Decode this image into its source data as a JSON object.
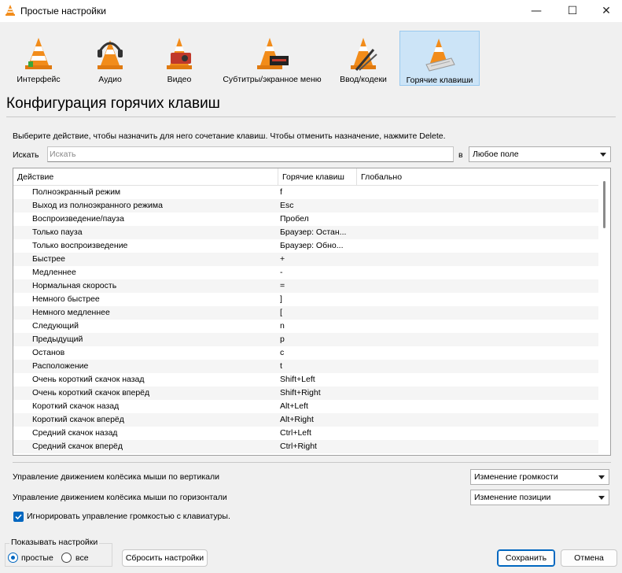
{
  "window": {
    "title": "Простые настройки",
    "minimize": "—",
    "maximize": "☐",
    "close": "✕"
  },
  "categories": [
    {
      "label": "Интерфейс",
      "icon": "cone-interface-icon",
      "selected": false
    },
    {
      "label": "Аудио",
      "icon": "cone-audio-icon",
      "selected": false
    },
    {
      "label": "Видео",
      "icon": "cone-video-icon",
      "selected": false
    },
    {
      "label": "Субтитры/экранное меню",
      "icon": "cone-subtitles-icon",
      "selected": false
    },
    {
      "label": "Ввод/кодеки",
      "icon": "cone-codecs-icon",
      "selected": false
    },
    {
      "label": "Горячие клавиши",
      "icon": "cone-hotkeys-icon",
      "selected": true
    }
  ],
  "page_title": "Конфигурация горячих клавиш",
  "hint": "Выберите действие, чтобы назначить для него сочетание клавиш. Чтобы отменить назначение, нажмите Delete.",
  "search": {
    "label": "Искать",
    "value": "",
    "placeholder": "Искать",
    "in_label": "в",
    "field_value": "Любое поле"
  },
  "table": {
    "headers": {
      "action": "Действие",
      "hotkey": "Горячие клавиш",
      "global": "Глобально"
    },
    "rows": [
      {
        "action": "Полноэкранный режим",
        "hotkey": "f"
      },
      {
        "action": "Выход из полноэкранного режима",
        "hotkey": "Esc"
      },
      {
        "action": "Воспроизведение/пауза",
        "hotkey": "Пробел"
      },
      {
        "action": "Только пауза",
        "hotkey": "Браузер: Остан..."
      },
      {
        "action": "Только воспроизведение",
        "hotkey": "Браузер: Обно..."
      },
      {
        "action": "Быстрее",
        "hotkey": "+"
      },
      {
        "action": "Медленнее",
        "hotkey": "-"
      },
      {
        "action": "Нормальная скорость",
        "hotkey": "="
      },
      {
        "action": "Немного быстрее",
        "hotkey": "]"
      },
      {
        "action": "Немного медленнее",
        "hotkey": "["
      },
      {
        "action": "Следующий",
        "hotkey": "n"
      },
      {
        "action": "Предыдущий",
        "hotkey": "p"
      },
      {
        "action": "Останов",
        "hotkey": "c"
      },
      {
        "action": "Расположение",
        "hotkey": "t"
      },
      {
        "action": "Очень короткий скачок назад",
        "hotkey": "Shift+Left"
      },
      {
        "action": "Очень короткий скачок вперёд",
        "hotkey": "Shift+Right"
      },
      {
        "action": "Короткий скачок назад",
        "hotkey": "Alt+Left"
      },
      {
        "action": "Короткий скачок вперёд",
        "hotkey": "Alt+Right"
      },
      {
        "action": "Средний скачок назад",
        "hotkey": "Ctrl+Left"
      },
      {
        "action": "Средний скачок вперёд",
        "hotkey": "Ctrl+Right"
      }
    ]
  },
  "options": {
    "wheel_vertical_label": "Управление движением колёсика мыши по вертикали",
    "wheel_vertical_value": "Изменение громкости",
    "wheel_horizontal_label": "Управление движением колёсика мыши по горизонтали",
    "wheel_horizontal_value": "Изменение позиции",
    "ignore_volume_label": "Игнорировать управление громкостью с клавиатуры.",
    "ignore_volume_checked": true
  },
  "show_settings": {
    "title": "Показывать настройки",
    "simple": "простые",
    "all": "все",
    "selected": "простые"
  },
  "buttons": {
    "reset": "Сбросить настройки",
    "save": "Сохранить",
    "cancel": "Отмена"
  },
  "colors": {
    "accent": "#0067c0",
    "selected_tab_bg": "#cce4f7",
    "cone_orange": "#f28c1a"
  }
}
